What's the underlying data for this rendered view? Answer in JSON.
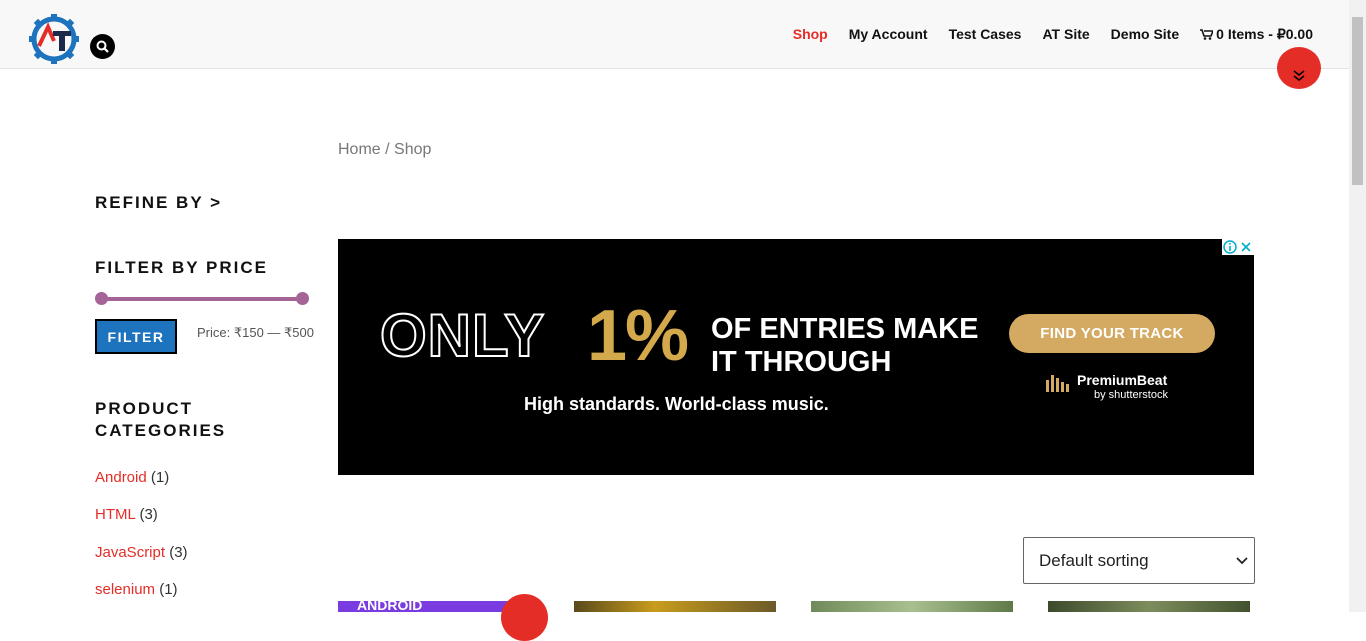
{
  "header": {
    "logo_text": "AT",
    "nav": [
      {
        "label": "Shop",
        "active": true
      },
      {
        "label": "My Account",
        "active": false
      },
      {
        "label": "Test Cases",
        "active": false
      },
      {
        "label": "AT Site",
        "active": false
      },
      {
        "label": "Demo Site",
        "active": false
      }
    ],
    "cart_label": "0 Items - ₽0.00"
  },
  "breadcrumb": {
    "home": "Home",
    "separator": " / ",
    "current": "Shop"
  },
  "sidebar": {
    "refine_heading": "REFINE BY >",
    "price_heading": "FILTER BY PRICE",
    "price_min_fraction": 0,
    "price_max_fraction": 1,
    "filter_button": "FILTER",
    "price_label": "Price: ₹150 — ₹500",
    "categories_heading_line1": "PRODUCT",
    "categories_heading_line2": "CATEGORIES",
    "categories": [
      {
        "name": "Android",
        "count": "(1)"
      },
      {
        "name": "HTML",
        "count": "(3)"
      },
      {
        "name": "JavaScript",
        "count": "(3)"
      },
      {
        "name": "selenium",
        "count": "(1)"
      }
    ]
  },
  "ad": {
    "only": "ONLY",
    "percent": "1%",
    "entries_line1": "OF ENTRIES MAKE",
    "entries_line2": "IT THROUGH",
    "tagline": "High standards. World-class music.",
    "button": "FIND YOUR TRACK",
    "brand": "PremiumBeat",
    "brand_sub": "by shutterstock"
  },
  "sorting": {
    "selected": "Default sorting"
  },
  "products": {
    "first_label": "ANDROID"
  },
  "colors": {
    "accent": "#e52d27",
    "slider": "#a46497",
    "filter_button": "#1e73be",
    "ad_gold": "#d4a94c"
  }
}
